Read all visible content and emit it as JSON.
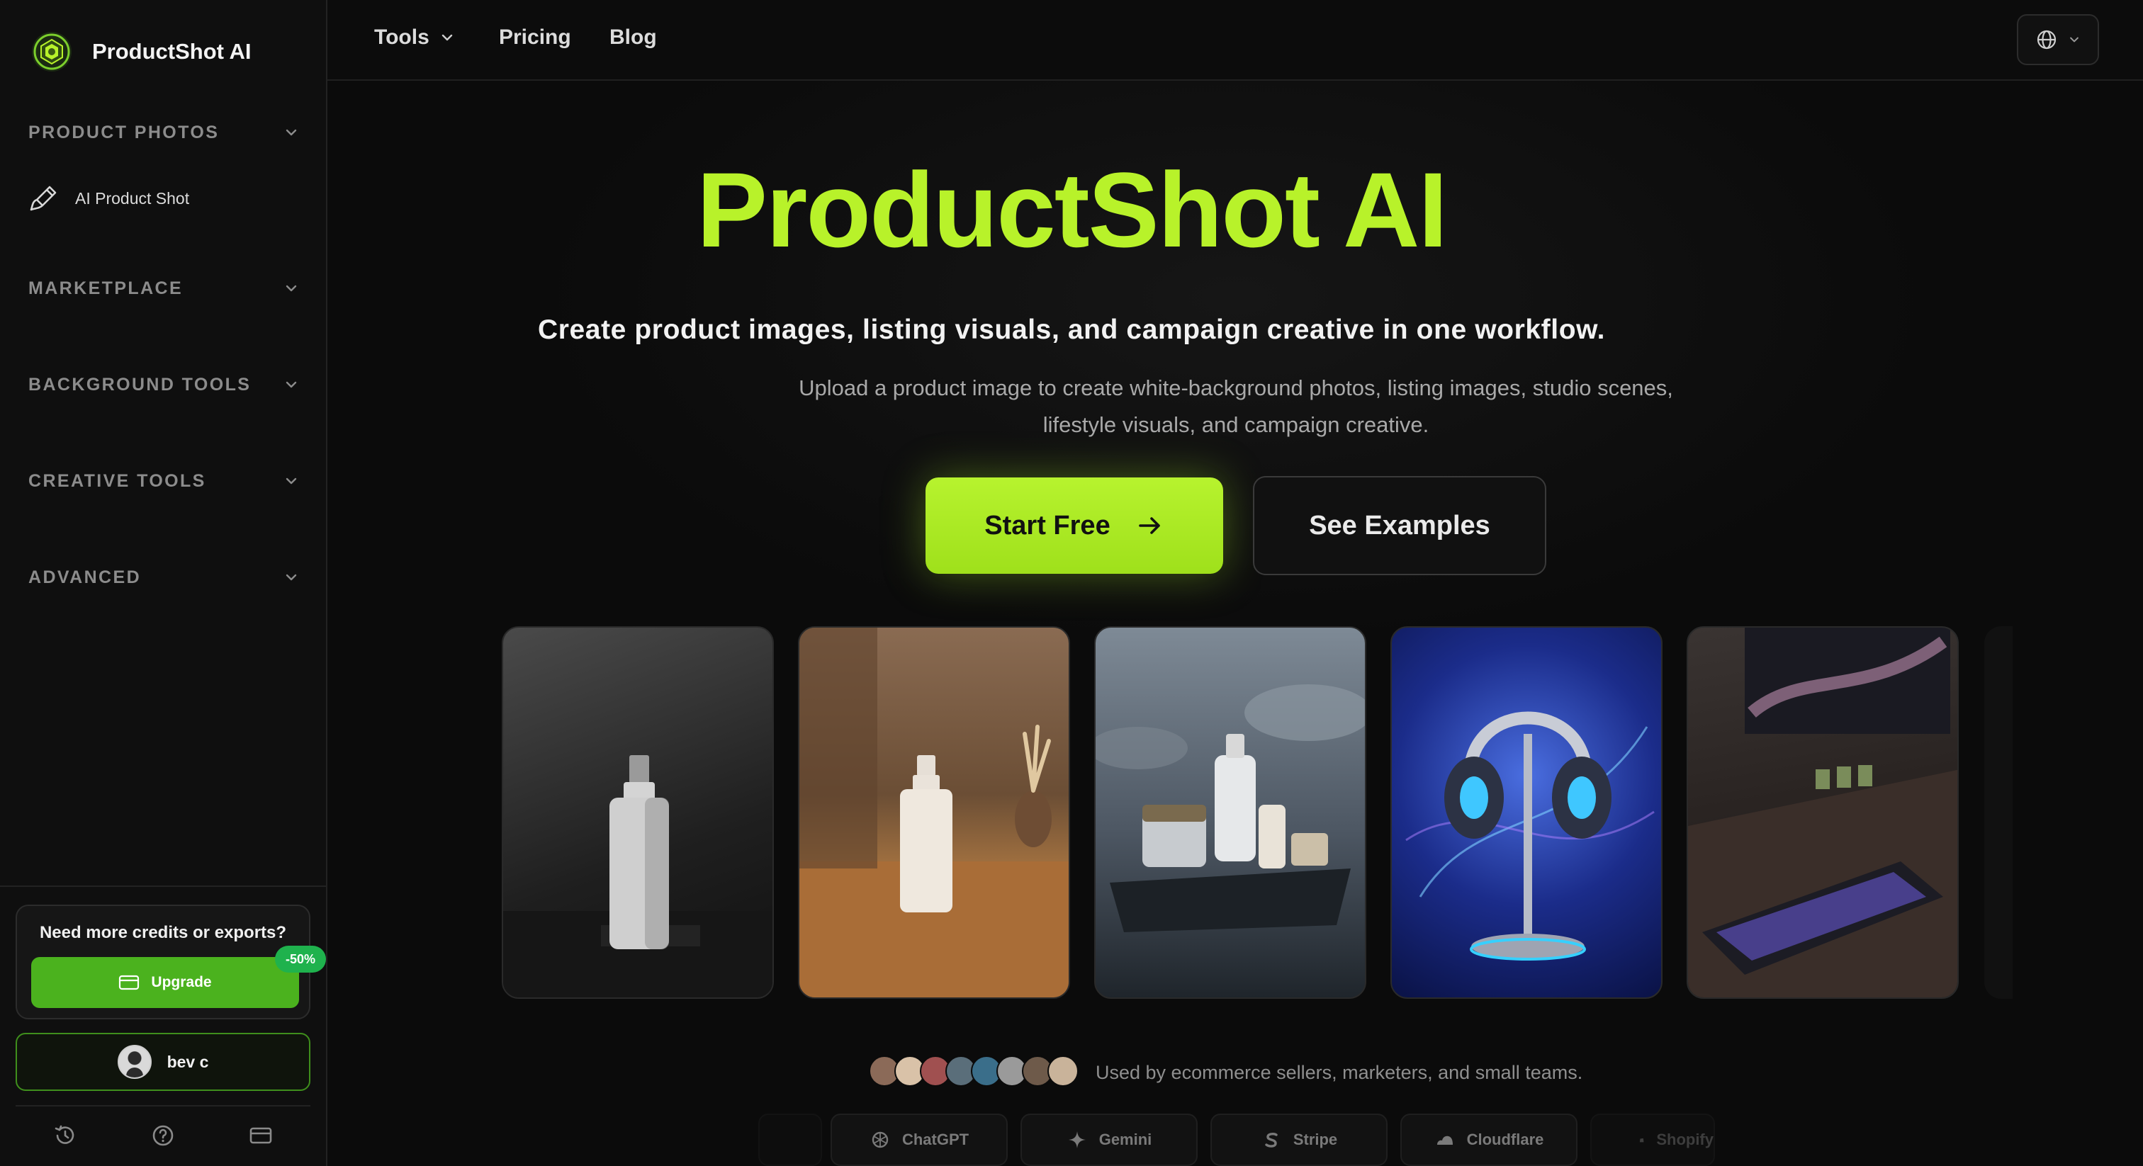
{
  "brand": {
    "name": "ProductShot AI"
  },
  "sidebar": {
    "sections": [
      {
        "label": "PRODUCT PHOTOS"
      },
      {
        "label": "MARKETPLACE"
      },
      {
        "label": "BACKGROUND TOOLS"
      },
      {
        "label": "CREATIVE TOOLS"
      },
      {
        "label": "ADVANCED"
      }
    ],
    "item": {
      "label": "AI Product Shot",
      "icon": "brush-icon"
    },
    "credits": {
      "title": "Need more credits or exports?",
      "upgrade_label": "Upgrade",
      "badge": "-50%"
    },
    "user": {
      "name": "bev c"
    },
    "footer_icons": [
      "history-icon",
      "help-icon",
      "billing-card-icon"
    ]
  },
  "topnav": {
    "items": [
      {
        "label": "Tools"
      },
      {
        "label": "Pricing"
      },
      {
        "label": "Blog"
      }
    ],
    "language_icon": "globe-icon"
  },
  "hero": {
    "title": "ProductShot AI",
    "subtitle": "Create product images, listing visuals, and campaign creative in one workflow.",
    "description": "Upload a product image to create white-background photos, listing images, studio scenes, lifestyle visuals, and campaign creative.",
    "primary_cta": "Start Free",
    "secondary_cta": "See Examples"
  },
  "trust": {
    "text": "Used by ecommerce sellers, marketers, and small teams.",
    "logos": [
      "ChatGPT",
      "Gemini",
      "Stripe",
      "Cloudflare",
      "Shopify"
    ]
  },
  "colors": {
    "accent": "#b8f22a",
    "upgrade_green": "#4bb21e",
    "badge_green": "#1fb24d",
    "background": "#0b0b0b"
  }
}
